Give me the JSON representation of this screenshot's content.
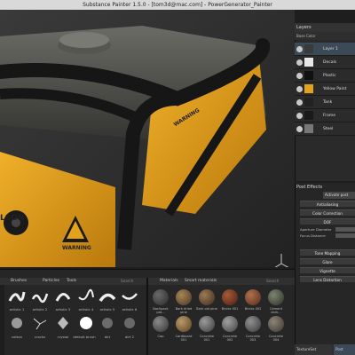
{
  "window": {
    "title": "Substance Painter 1.5.0 - [tom3d@mac.com] - PowerGenerator_Painter"
  },
  "layers": {
    "header": "Layers",
    "channel": "Base Color",
    "items": [
      {
        "label": "Layer 1",
        "selected": true
      },
      {
        "label": "Decals",
        "selected": false
      },
      {
        "label": "Plastic",
        "selected": false
      },
      {
        "label": "Yellow Paint",
        "selected": false
      },
      {
        "label": "Tank",
        "selected": false
      },
      {
        "label": "Frame",
        "selected": false
      },
      {
        "label": "Steel",
        "selected": false
      }
    ]
  },
  "post_effects": {
    "title": "Post Effects",
    "activate_label": "Activate post",
    "sections": [
      "Antialiasing",
      "Color Correction",
      "DOF",
      "Tone Mapping",
      "Glare",
      "Vignette",
      "Lens Distortion"
    ],
    "dof_params": [
      "Aperture Diameter",
      "Focus Distance"
    ],
    "tabs": [
      "TextureSet Settings",
      "Post Effects"
    ]
  },
  "shelf": {
    "brush_tabs": [
      "Brushes",
      "Particles",
      "Tools"
    ],
    "material_tabs": [
      "Materials",
      "Smart materials"
    ],
    "search_label": "Search",
    "brushes_row1": [
      "artistic 1",
      "artistic 2",
      "artistic 3",
      "artistic 4",
      "artistic 5",
      "artistic 6"
    ],
    "brushes_row2": [
      "cotton",
      "cracks",
      "crystal",
      "default brush",
      "dirt",
      "dirt 2"
    ],
    "materials_row1": [
      "Backpack pat...",
      "Bark dried pine",
      "Bark old pine",
      "Bricks 001",
      "Bricks 002",
      "Cement dark..."
    ],
    "materials_row2": [
      "Cap",
      "Cardboard 001",
      "Concrete 001",
      "Concrete 002",
      "Concrete 003",
      "Concrete 004"
    ]
  },
  "viewport_text": {
    "decal_main": "WARNING",
    "decal_side": "WARNING",
    "brand": "LSON"
  },
  "colors": {
    "yellow_paint": "#e2a21a",
    "frame": "#1b1b1b",
    "accent_selected": "#3c4a57"
  }
}
